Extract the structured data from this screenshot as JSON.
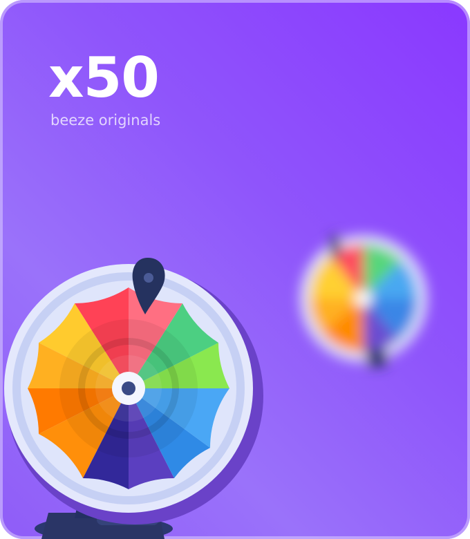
{
  "promo": {
    "multiplier": "x50",
    "subtitle": "beeze originals"
  },
  "colors": {
    "card_gradient_start": "#8a38ff",
    "card_gradient_end": "#9a72fa",
    "wheel_rim": "#dbe2fa",
    "pointer": "#263465",
    "stand": "#2b3870"
  },
  "icons": [
    "spin-wheel-icon",
    "spin-wheel-blurred-icon",
    "wheel-pointer-icon",
    "wheel-stand-icon"
  ]
}
